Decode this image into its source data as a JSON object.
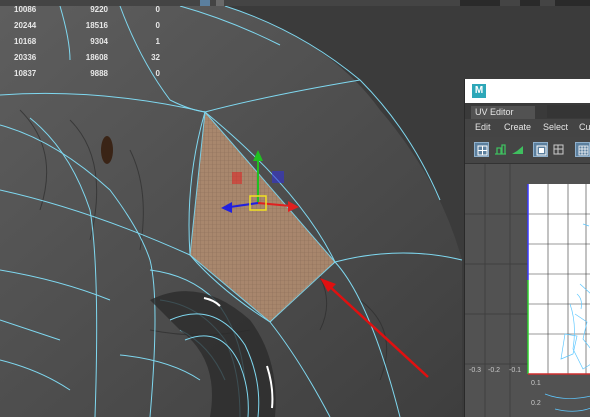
{
  "stats": [
    {
      "a": "10086",
      "b": "9220",
      "c": "0"
    },
    {
      "a": "20244",
      "b": "18516",
      "c": "0"
    },
    {
      "a": "10168",
      "b": "9304",
      "c": "1"
    },
    {
      "a": "20336",
      "b": "18608",
      "c": "32"
    },
    {
      "a": "10837",
      "b": "9888",
      "c": "0"
    }
  ],
  "uv_editor": {
    "logo_letter": "M",
    "tab_title": "UV Editor",
    "menus": [
      "Edit",
      "Create",
      "Select",
      "Cu"
    ],
    "tick_labels": {
      "x_neg": "-0.3",
      "x_neg2": "-0.2",
      "x_neg1": "-0.1",
      "y1": "0.1",
      "y2": "0.2"
    }
  },
  "colors": {
    "wireframe": "#7fd8f0",
    "selection": "#b08c70",
    "manip_x": "#e02020",
    "manip_y": "#20c020",
    "manip_z": "#2020e0",
    "annotation_arrow": "#e01010",
    "uv_u_axis": "#d03030",
    "uv_v_axis": "#30d030",
    "uv_edge_blue": "#3a3aff"
  }
}
